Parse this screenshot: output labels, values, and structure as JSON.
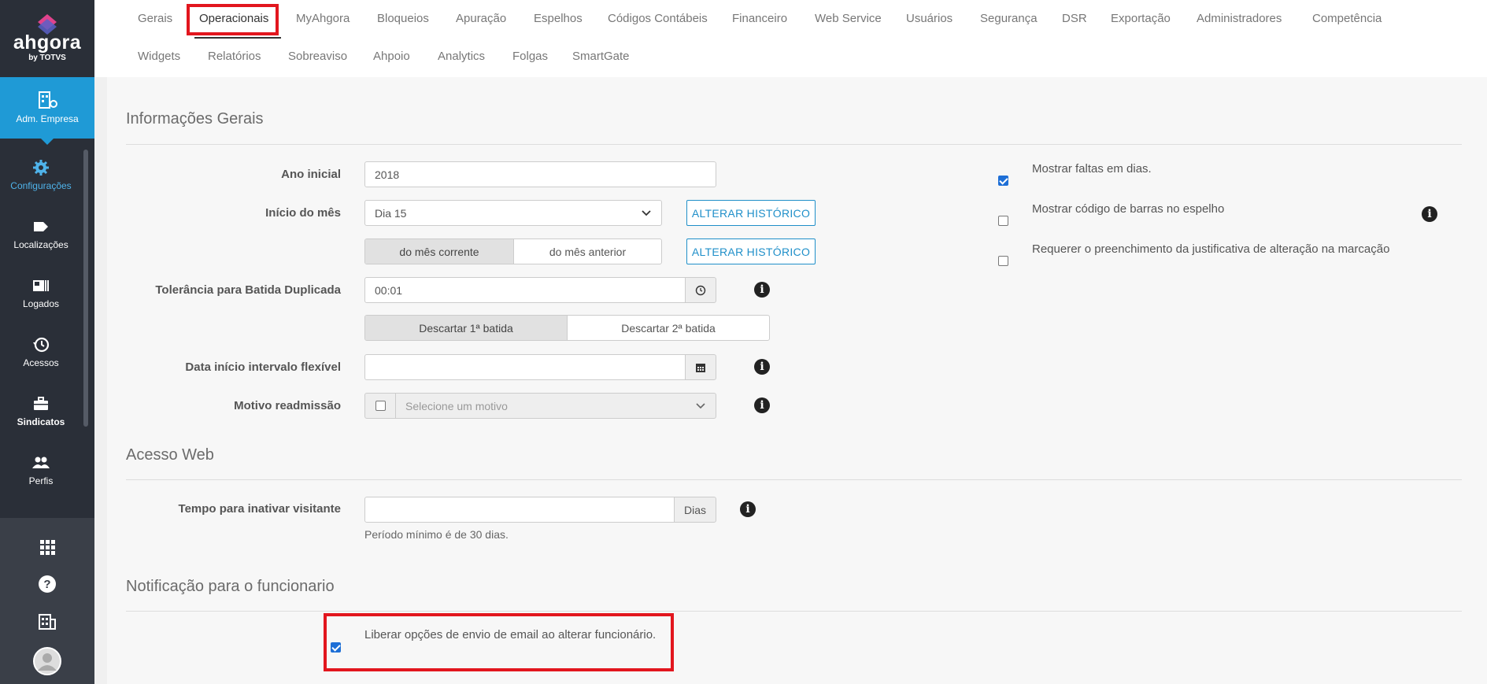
{
  "app": {
    "brand": "ahgora",
    "brand_by": "by TOTVS"
  },
  "sidebar": {
    "active": {
      "label": "Adm. Empresa",
      "icon": "building-gear-icon"
    },
    "items": [
      {
        "label": "Configurações",
        "icon": "gear-icon"
      },
      {
        "label": "Localizações",
        "icon": "tag-icon"
      },
      {
        "label": "Logados",
        "icon": "id-card-icon"
      },
      {
        "label": "Acessos",
        "icon": "history-icon"
      },
      {
        "label": "Sindicatos",
        "icon": "briefcase-icon"
      },
      {
        "label": "Perfis",
        "icon": "users-icon"
      }
    ],
    "bottom": [
      "apps-grid-icon",
      "help-icon",
      "company-icon",
      "avatar"
    ]
  },
  "tabs": {
    "row1": [
      "Gerais",
      "Operacionais",
      "MyAhgora",
      "Bloqueios",
      "Apuração",
      "Espelhos",
      "Códigos Contábeis",
      "Financeiro",
      "Web Service",
      "Usuários",
      "Segurança",
      "DSR",
      "Exportação",
      "Administradores",
      "Competência"
    ],
    "row2": [
      "Widgets",
      "Relatórios",
      "Sobreaviso",
      "Ahpoio",
      "Analytics",
      "Folgas",
      "SmartGate"
    ],
    "active": "Operacionais"
  },
  "info_gerais": {
    "title": "Informações Gerais",
    "ano_inicial": {
      "label": "Ano inicial",
      "value": "2018"
    },
    "inicio_mes": {
      "label": "Início do mês",
      "value": "Dia 15",
      "button": "ALTERAR HISTÓRICO"
    },
    "mes_toggle": {
      "options": [
        "do mês corrente",
        "do mês anterior"
      ],
      "selected": "do mês corrente",
      "button": "ALTERAR HISTÓRICO"
    },
    "tolerancia": {
      "label": "Tolerância para Batida Duplicada",
      "value": "00:01"
    },
    "descartar": {
      "options": [
        "Descartar 1ª batida",
        "Descartar 2ª batida"
      ],
      "selected": "Descartar 1ª batida"
    },
    "data_intervalo": {
      "label": "Data início intervalo flexível",
      "value": ""
    },
    "motivo": {
      "label": "Motivo readmissão",
      "placeholder": "Selecione um motivo",
      "checked": false
    },
    "checks": [
      {
        "label": "Mostrar faltas em dias.",
        "checked": true
      },
      {
        "label": "Mostrar código de barras no espelho",
        "checked": false
      },
      {
        "label": "Requerer o preenchimento da justificativa de alteração na marcação",
        "checked": false
      }
    ]
  },
  "acesso_web": {
    "title": "Acesso Web",
    "tempo": {
      "label": "Tempo para inativar visitante",
      "value": "",
      "unit": "Dias",
      "help": "Período mínimo é de 30 dias."
    }
  },
  "notificacao": {
    "title": "Notificação para o funcionario",
    "check": {
      "label": "Liberar opções de envio de email ao alterar funcionário.",
      "checked": true
    }
  },
  "colors": {
    "accent": "#1f9ad6",
    "highlight": "#e2161e",
    "sidebar": "#2a2f38"
  }
}
